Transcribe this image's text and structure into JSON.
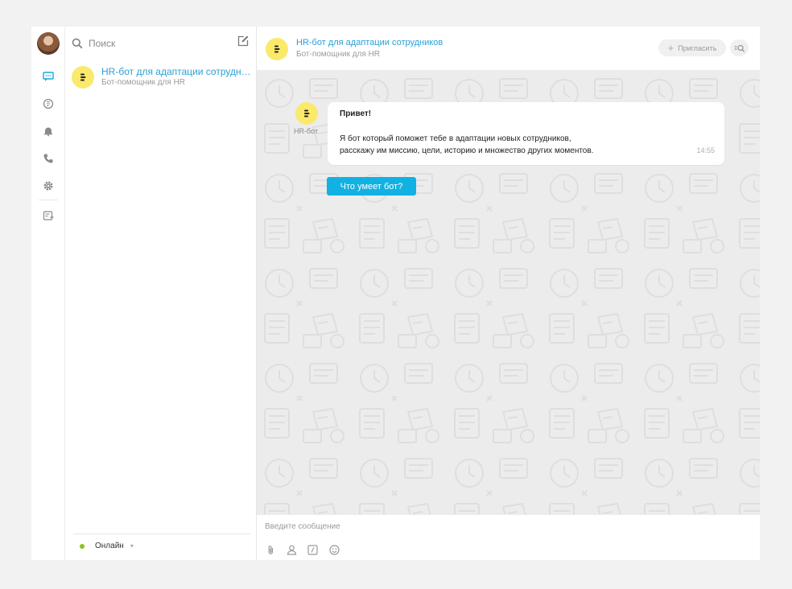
{
  "sidebar": {
    "icons": [
      "chat-icon",
      "channels-icon",
      "notifications-icon",
      "calls-icon",
      "settings-icon",
      "contacts-icon"
    ]
  },
  "chat_list": {
    "search_placeholder": "Поиск",
    "items": [
      {
        "title": "HR-бот для адаптации сотрудни...",
        "subtitle": "Бот-помощник для HR"
      }
    ],
    "status": "Онлайн"
  },
  "header": {
    "title": "HR-бот для адаптации сотрудников",
    "subtitle": "Бот-помощник для HR",
    "invite_label": "Пригласить"
  },
  "messages": [
    {
      "author": "HR-бот",
      "title": "Привет!",
      "line1": "Я бот который поможет тебе в адаптации новых сотрудников,",
      "line2": "расскажу им миссию, цели, историю и множество других моментов.",
      "time": "14:55"
    }
  ],
  "action_button": "Что умеет бот?",
  "composer": {
    "placeholder": "Введите сообщение"
  },
  "colors": {
    "accent": "#12b1e3",
    "link": "#2a9fd6",
    "bot_avatar": "#fbe96b",
    "online": "#8ac31f"
  }
}
